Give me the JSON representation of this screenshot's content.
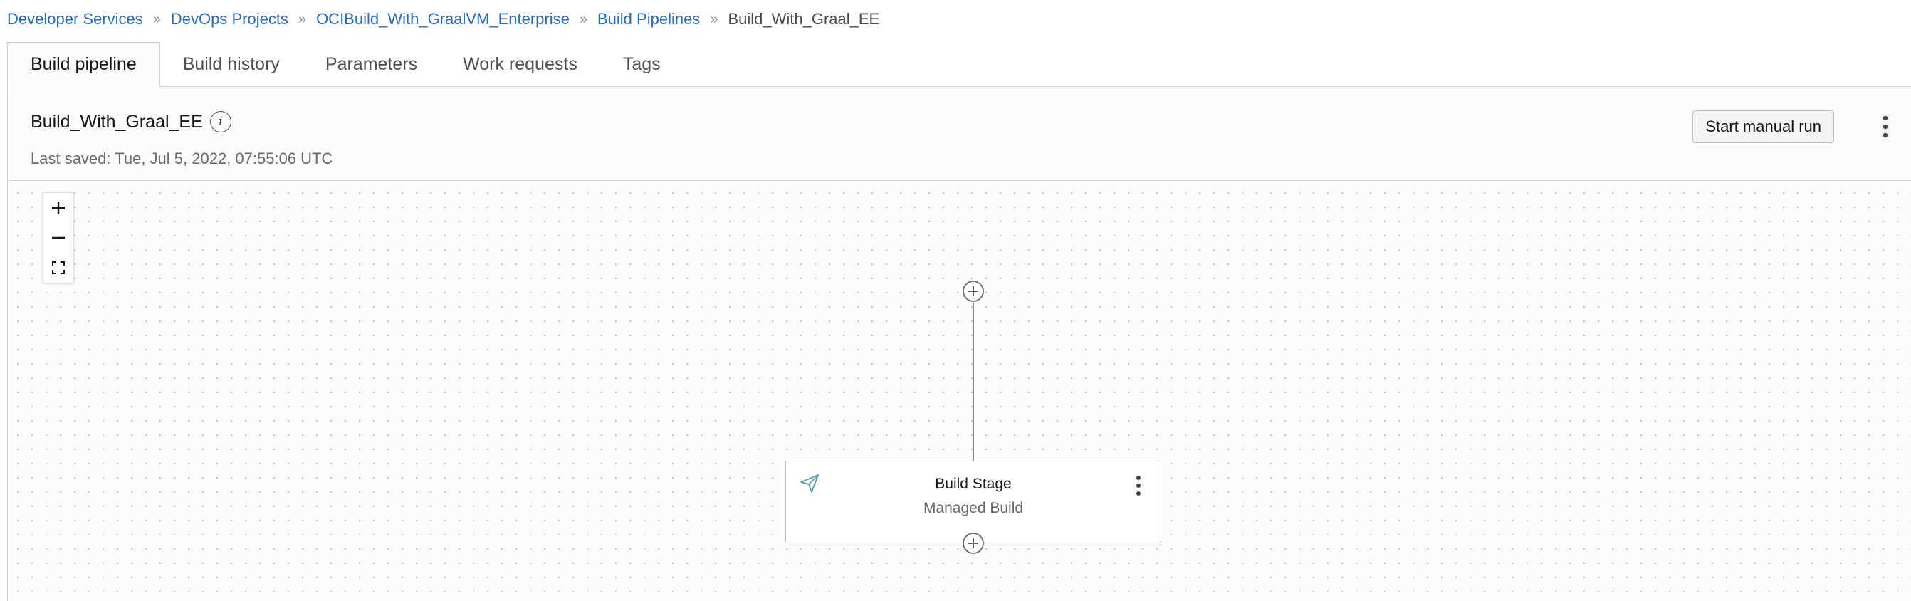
{
  "breadcrumb": {
    "items": [
      "Developer Services",
      "DevOps Projects",
      "OCIBuild_With_GraalVM_Enterprise",
      "Build Pipelines"
    ],
    "separator": "»",
    "current": "Build_With_Graal_EE"
  },
  "tabs": [
    {
      "label": "Build pipeline",
      "active": true
    },
    {
      "label": "Build history",
      "active": false
    },
    {
      "label": "Parameters",
      "active": false
    },
    {
      "label": "Work requests",
      "active": false
    },
    {
      "label": "Tags",
      "active": false
    }
  ],
  "header": {
    "pipeline_name": "Build_With_Graal_EE",
    "info_glyph": "i",
    "last_saved": "Last saved: Tue, Jul 5, 2022, 07:55:06 UTC",
    "start_button_label": "Start manual run"
  },
  "zoom": {
    "zoom_in_icon": "plus-icon",
    "zoom_out_icon": "minus-icon",
    "fit_icon": "fit-screen-icon"
  },
  "stage": {
    "title": "Build Stage",
    "subtitle": "Managed Build",
    "icon": "send-icon"
  },
  "colors": {
    "link": "#2b6cb0",
    "stage_icon": "#5b9aa8",
    "canvas_bg": "#fbfbfb"
  }
}
